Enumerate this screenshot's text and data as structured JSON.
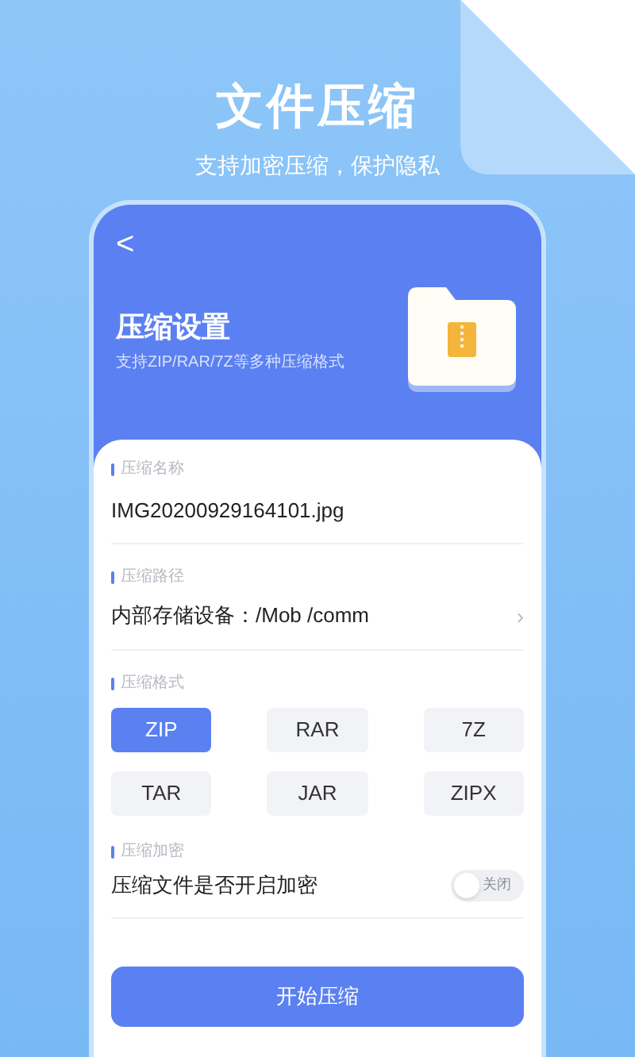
{
  "headline": "文件压缩",
  "tagline": "支持加密压缩，保护隐私",
  "header": {
    "back": "<",
    "title": "压缩设置",
    "subtitle": "支持ZIP/RAR/7Z等多种压缩格式"
  },
  "name_section": {
    "label": "压缩名称",
    "value": "IMG20200929164101.jpg"
  },
  "path_section": {
    "label": "压缩路径",
    "value": "内部存储设备：/Mob /comm",
    "chevron": "›"
  },
  "format_section": {
    "label": "压缩格式",
    "options": [
      {
        "label": "ZIP",
        "selected": true
      },
      {
        "label": "RAR",
        "selected": false
      },
      {
        "label": "7Z",
        "selected": false
      },
      {
        "label": "TAR",
        "selected": false
      },
      {
        "label": "JAR",
        "selected": false
      },
      {
        "label": "ZIPX",
        "selected": false
      }
    ]
  },
  "encrypt_section": {
    "label": "压缩加密",
    "text": "压缩文件是否开启加密",
    "toggle": {
      "on": false,
      "label": "关闭"
    }
  },
  "start_button": "开始压缩"
}
